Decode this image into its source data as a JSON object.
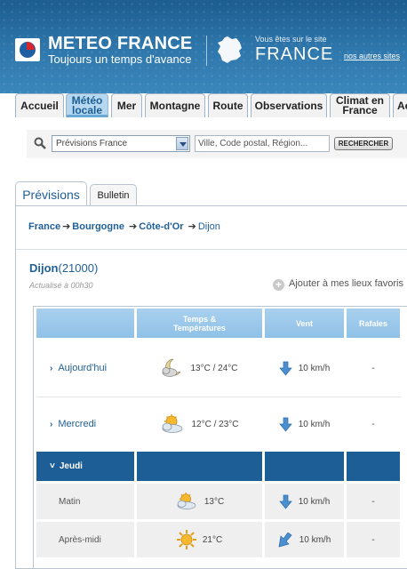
{
  "header": {
    "brand": "METEO FRANCE",
    "tagline": "Toujours un temps d'avance",
    "site_intro": "Vous êtes sur le site",
    "site_name": "FRANCE",
    "other_sites": "nos autres sites"
  },
  "tabs": [
    {
      "label": "Accueil",
      "active": false
    },
    {
      "label": "Météo locale",
      "active": true
    },
    {
      "label": "Mer",
      "active": false
    },
    {
      "label": "Montagne",
      "active": false
    },
    {
      "label": "Route",
      "active": false
    },
    {
      "label": "Observations",
      "active": false
    },
    {
      "label": "Climat en France",
      "active": false
    },
    {
      "label": "Ac",
      "active": false
    }
  ],
  "search": {
    "select_value": "Prévisions France",
    "placeholder": "Ville, Code postal, Région...",
    "button": "RECHERCHER"
  },
  "panel_tabs": {
    "previsions": "Prévisions",
    "bulletin": "Bulletin"
  },
  "breadcrumb": {
    "france": "France",
    "region": "Bourgogne",
    "dept": "Côte-d'Or",
    "city": "Dijon"
  },
  "location": {
    "city": "Dijon",
    "zip": "(21000)",
    "updated": "Actualisé à 00h30",
    "favorite": "Ajouter à mes lieux favoris"
  },
  "table": {
    "headers": {
      "temps": "Temps & Températures",
      "vent": "Vent",
      "rafales": "Rafales"
    },
    "rows": [
      {
        "label": "Aujourd'hui",
        "icon": "moon-cloud-icon",
        "temp": "13°C / 24°C",
        "wind": "10 km/h",
        "gusts": "-"
      },
      {
        "label": "Mercredi",
        "icon": "sun-cloud-icon",
        "temp": "12°C / 23°C",
        "wind": "10 km/h",
        "gusts": "-"
      }
    ],
    "expanded_day": "Jeudi",
    "subrows": [
      {
        "label": "Matin",
        "icon": "sun-cloud-icon",
        "temp": "13°C",
        "wind": "10 km/h",
        "gusts": "-"
      },
      {
        "label": "Après-midi",
        "icon": "sun-icon",
        "temp": "21°C",
        "wind": "10 km/h",
        "gusts": "-"
      }
    ]
  },
  "colors": {
    "brand_blue": "#1f5f98",
    "header_blue": "#2f78ad",
    "table_header": "#9cc8eb",
    "row_highlight": "#1e5e97"
  }
}
